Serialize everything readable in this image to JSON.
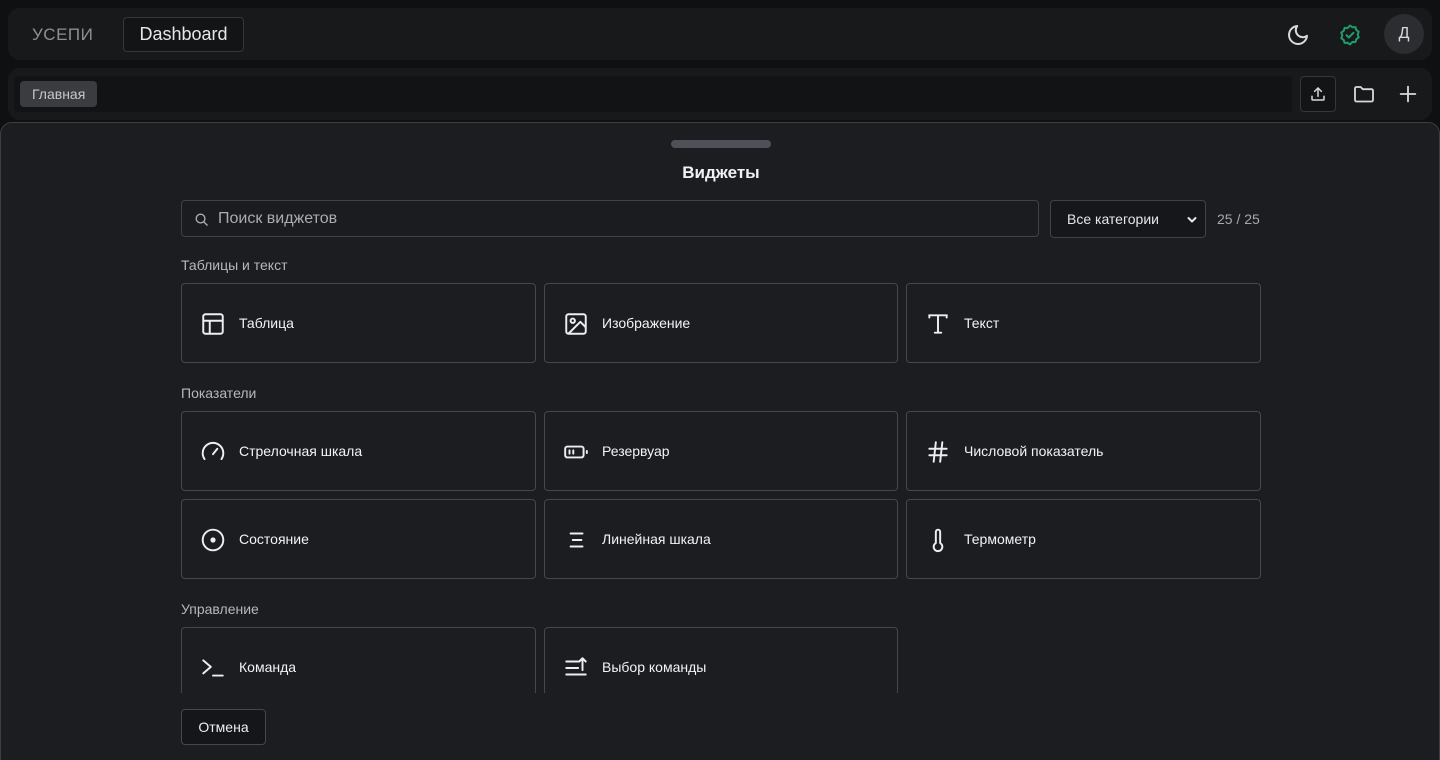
{
  "app": {
    "brand": "УСЕПИ",
    "dashboard_label": "Dashboard",
    "avatar_letter": "Д"
  },
  "tabs": {
    "main_label": "Главная"
  },
  "sheet": {
    "title": "Виджеты",
    "search_placeholder": "Поиск виджетов",
    "category_selected": "Все категории",
    "count": "25 / 25",
    "cancel_label": "Отмена"
  },
  "sections": [
    {
      "title": "Таблицы и текст",
      "items": [
        {
          "label": "Таблица",
          "icon": "table-icon"
        },
        {
          "label": "Изображение",
          "icon": "image-icon"
        },
        {
          "label": "Текст",
          "icon": "text-icon"
        }
      ]
    },
    {
      "title": "Показатели",
      "items": [
        {
          "label": "Стрелочная шкала",
          "icon": "gauge-icon"
        },
        {
          "label": "Резервуар",
          "icon": "tank-icon"
        },
        {
          "label": "Числовой показатель",
          "icon": "hash-icon"
        },
        {
          "label": "Состояние",
          "icon": "status-icon"
        },
        {
          "label": "Линейная шкала",
          "icon": "linear-scale-icon"
        },
        {
          "label": "Термометр",
          "icon": "thermometer-icon"
        }
      ]
    },
    {
      "title": "Управление",
      "items": [
        {
          "label": "Команда",
          "icon": "terminal-icon"
        },
        {
          "label": "Выбор команды",
          "icon": "command-select-icon"
        }
      ]
    }
  ],
  "colors": {
    "accent_status": "#1f9d6b",
    "background": "#1b1d20"
  }
}
